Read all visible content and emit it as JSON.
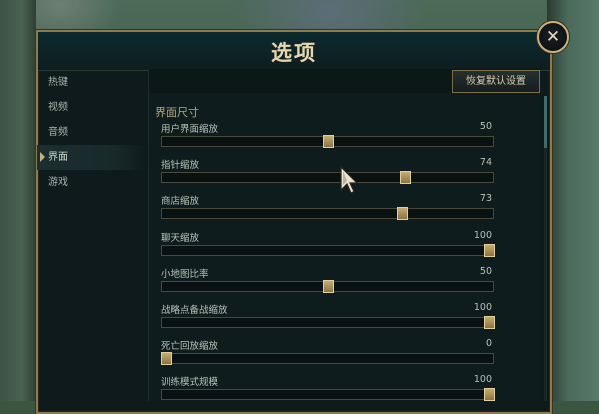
{
  "dialog": {
    "title": "选项",
    "close_glyph": "✕",
    "reset_label": "恢复默认设置"
  },
  "sidebar": {
    "items": [
      {
        "label": "热键",
        "active": false
      },
      {
        "label": "视频",
        "active": false
      },
      {
        "label": "音频",
        "active": false
      },
      {
        "label": "界面",
        "active": true
      },
      {
        "label": "游戏",
        "active": false
      }
    ]
  },
  "section": {
    "title": "界面尺寸",
    "settings": [
      {
        "label": "用户界面缩放",
        "value": "50",
        "fraction": 0.5
      },
      {
        "label": "指针缩放",
        "value": "74",
        "fraction": 0.74
      },
      {
        "label": "商店缩放",
        "value": "73",
        "fraction": 0.73
      },
      {
        "label": "聊天缩放",
        "value": "100",
        "fraction": 1.0
      },
      {
        "label": "小地图比率",
        "value": "50",
        "fraction": 0.5
      },
      {
        "label": "战略点备战缩放",
        "value": "100",
        "fraction": 1.0
      },
      {
        "label": "死亡回放缩放",
        "value": "0",
        "fraction": 0.0
      },
      {
        "label": "训练模式规模",
        "value": "100",
        "fraction": 1.0
      }
    ]
  },
  "icons": {
    "close": "close-icon",
    "cursor": "mouse-pointer-icon",
    "active_marker": "triangle-right-icon"
  },
  "colors": {
    "accent_gold": "#c8b17a",
    "panel_bg": "#0f1c1e",
    "frame": "#8d7a4f"
  }
}
